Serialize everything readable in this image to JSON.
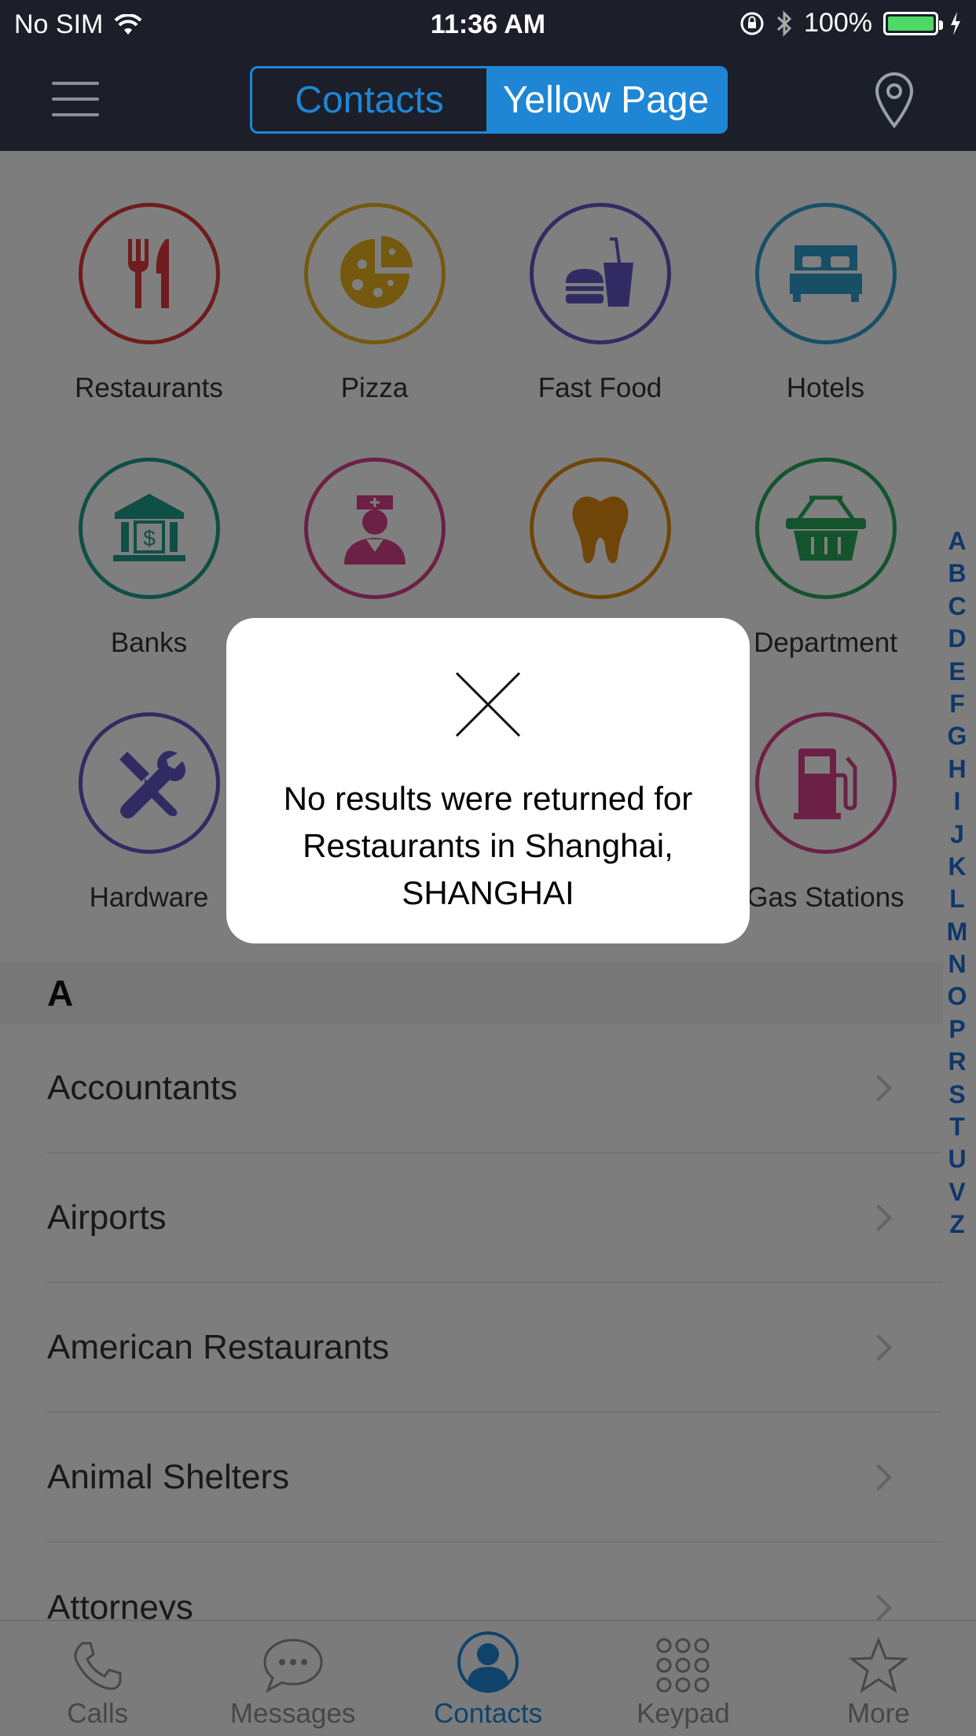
{
  "status_bar": {
    "carrier": "No SIM",
    "time": "11:36 AM",
    "battery": "100%"
  },
  "nav": {
    "tabs": [
      {
        "label": "Contacts",
        "active": false
      },
      {
        "label": "Yellow Page",
        "active": true
      }
    ]
  },
  "categories": [
    {
      "label": "Restaurants",
      "icon": "fork-knife-icon",
      "color": "#e0383c"
    },
    {
      "label": "Pizza",
      "icon": "pizza-icon",
      "color": "#e8b21c"
    },
    {
      "label": "Fast Food",
      "icon": "burger-drink-icon",
      "color": "#6456c6"
    },
    {
      "label": "Hotels",
      "icon": "bed-icon",
      "color": "#2f9fcf"
    },
    {
      "label": "Banks",
      "icon": "bank-icon",
      "color": "#1e9e8a"
    },
    {
      "label": "",
      "icon": "nurse-icon",
      "color": "#d9418b"
    },
    {
      "label": "",
      "icon": "tooth-icon",
      "color": "#e08a12"
    },
    {
      "label": "Department",
      "icon": "basket-icon",
      "color": "#29a85a"
    },
    {
      "label": "Hardware",
      "icon": "tools-icon",
      "color": "#6456c6"
    },
    {
      "label": "Gas Stations",
      "icon": "gas-pump-icon",
      "color": "#d9418b"
    }
  ],
  "section": {
    "letter": "A"
  },
  "list_items": [
    "Accountants",
    "Airports",
    "American Restaurants",
    "Animal Shelters",
    "Attorneys"
  ],
  "index_letters": [
    "A",
    "B",
    "C",
    "D",
    "E",
    "F",
    "G",
    "H",
    "I",
    "J",
    "K",
    "L",
    "M",
    "N",
    "O",
    "P",
    "R",
    "S",
    "T",
    "U",
    "V",
    "Z"
  ],
  "tab_bar": [
    {
      "label": "Calls",
      "icon": "phone-icon",
      "active": false
    },
    {
      "label": "Messages",
      "icon": "chat-bubble-icon",
      "active": false
    },
    {
      "label": "Contacts",
      "icon": "person-icon",
      "active": true
    },
    {
      "label": "Keypad",
      "icon": "keypad-icon",
      "active": false
    },
    {
      "label": "More",
      "icon": "star-icon",
      "active": false
    }
  ],
  "alert": {
    "message": "No results were returned for Restaurants in Shanghai, SHANGHAI"
  }
}
